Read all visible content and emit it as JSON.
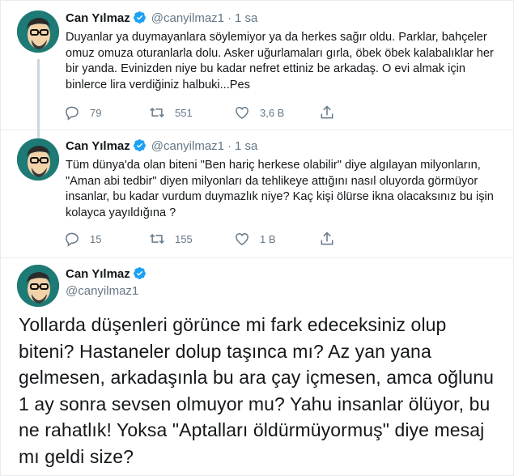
{
  "author": {
    "name": "Can Yılmaz",
    "handle": "@canyilmaz1",
    "verified": true
  },
  "colors": {
    "verified_badge": "#1da1f2",
    "secondary_text": "#657786",
    "divider": "#e6ecf0",
    "avatar_bg": "#1d7a74"
  },
  "tweets": [
    {
      "separator": "·",
      "time": "1 sa",
      "text": "Duyanlar ya duymayanlara söylemiyor ya da herkes sağır oldu. Parklar, bahçeler omuz omuza oturanlarla dolu. Asker uğurlamaları gırla, öbek öbek kalabalıklar her bir yanda. Evinizden niye bu kadar nefret ettiniz be arkadaş. O evi almak için binlerce lira verdiğiniz halbuki...Pes",
      "replies": "79",
      "retweets": "551",
      "likes": "3,6 B"
    },
    {
      "separator": "·",
      "time": "1 sa",
      "text": "Tüm dünya'da olan biteni \"Ben hariç herkese olabilir\" diye algılayan milyonların, \"Aman abi tedbir\" diyen milyonları da tehlikeye attığını nasıl oluyorda görmüyor insanlar, bu kadar vurdum duymazlık niye? Kaç kişi ölürse ikna olacaksınız bu işin kolayca yayıldığına ?",
      "replies": "15",
      "retweets": "155",
      "likes": "1 B"
    }
  ],
  "main_tweet": {
    "text": "Yollarda düşenleri görünce mi fark edeceksiniz olup biteni? Hastaneler dolup taşınca mı? Az yan yana gelmesen, arkadaşınla bu ara çay içmesen, amca oğlunu 1 ay sonra sevsen olmuyor mu? Yahu insanlar ölüyor, bu ne rahatlık! Yoksa \"Aptalları öldürmüyormuş\" diye mesaj mı geldi size?"
  },
  "icons": [
    "reply-icon",
    "retweet-icon",
    "like-icon",
    "share-icon",
    "verified-badge-icon"
  ]
}
